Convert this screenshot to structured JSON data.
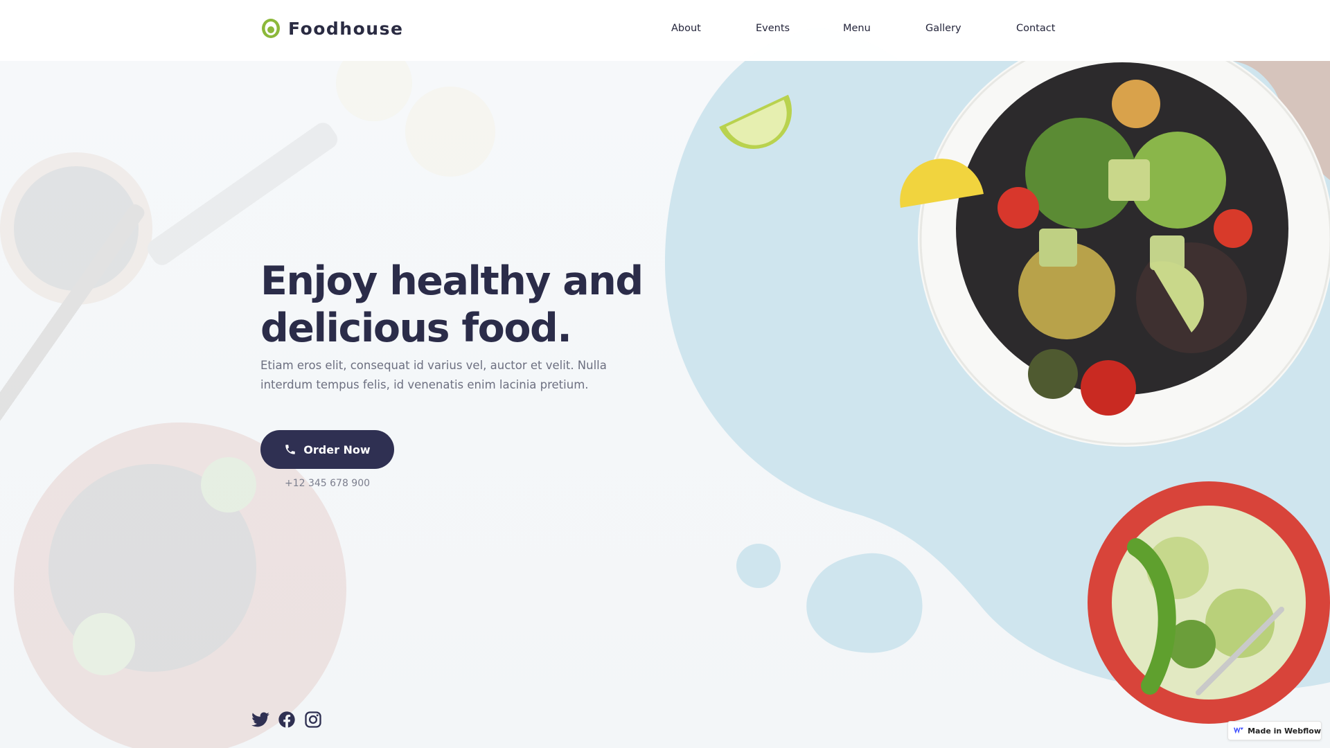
{
  "brand": {
    "name": "Foodhouse",
    "accent": "#8cb83a"
  },
  "nav": {
    "items": [
      "About",
      "Events",
      "Menu",
      "Gallery",
      "Contact"
    ]
  },
  "hero": {
    "headline": "Enjoy healthy and\ndelicious food.",
    "subtext": "Etiam eros elit, consequat id varius vel, auctor et velit. Nulla\ninterdum tempus felis, id venenatis enim lacinia pretium.",
    "cta_label": "Order Now",
    "cta_icon": "phone-icon",
    "phone_number": "+12 345 678 900"
  },
  "social": {
    "icons": [
      "twitter-icon",
      "facebook-icon",
      "instagram-icon"
    ]
  },
  "badge": {
    "label": "Made in Webflow",
    "icon": "webflow-icon"
  },
  "colors": {
    "dark": "#2f3052",
    "heading": "#2b2c49",
    "body_text": "#6c6f80",
    "blob": "#cfe6ee"
  }
}
